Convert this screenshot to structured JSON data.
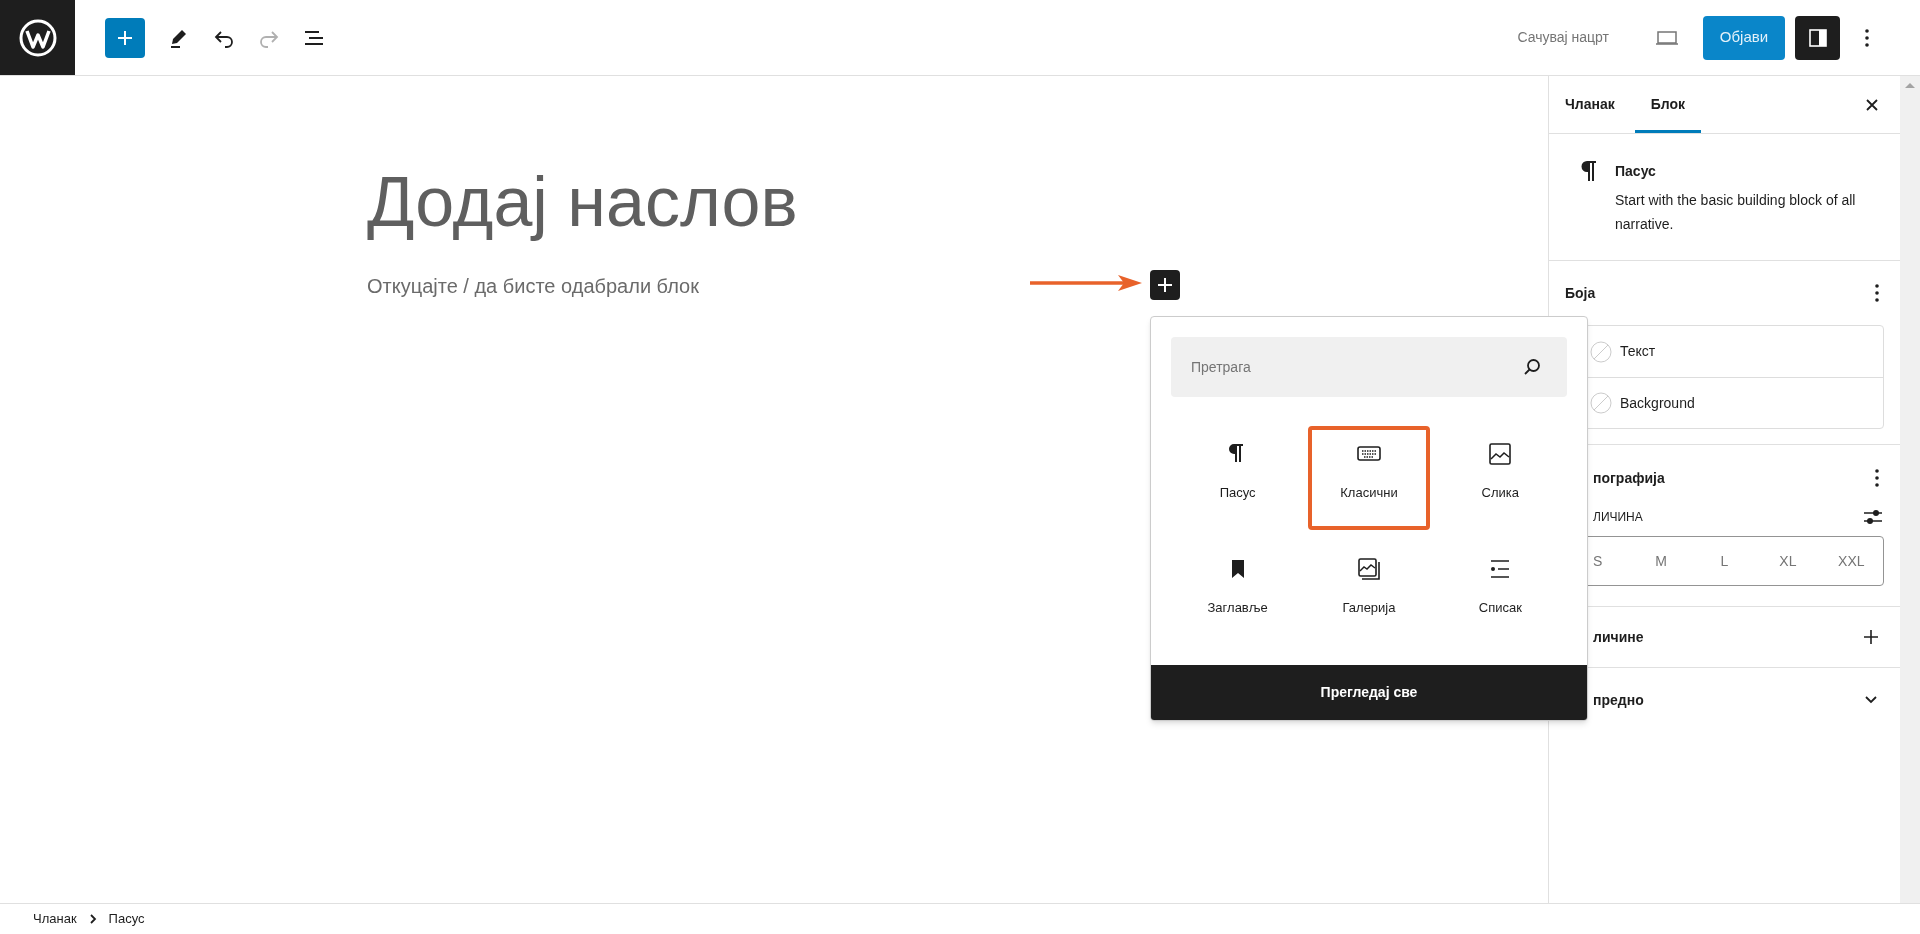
{
  "toolbar": {
    "save_draft": "Сачувај нацрт",
    "publish": "Објави"
  },
  "editor": {
    "title_placeholder": "Додај наслов",
    "paragraph_placeholder": "Откуцајте / да бисте одабрали блок"
  },
  "inserter": {
    "search_placeholder": "Претрага",
    "blocks": [
      {
        "kind": "paragraph",
        "label": "Пасус",
        "highlighted": false
      },
      {
        "kind": "classic",
        "label": "Класични",
        "highlighted": true
      },
      {
        "kind": "image",
        "label": "Слика",
        "highlighted": false
      },
      {
        "kind": "heading",
        "label": "Заглавље",
        "highlighted": false
      },
      {
        "kind": "gallery",
        "label": "Галерија",
        "highlighted": false
      },
      {
        "kind": "list",
        "label": "Списак",
        "highlighted": false
      }
    ],
    "browse_all": "Прегледај све"
  },
  "sidebar": {
    "tabs": [
      {
        "label": "Чланак",
        "selected": false
      },
      {
        "label": "Блок",
        "selected": true
      }
    ],
    "block": {
      "name": "Пасус",
      "description": "Start with the basic building block of all narrative."
    },
    "color": {
      "title": "Боја",
      "options": [
        "Текст",
        "Background"
      ]
    },
    "typography": {
      "title": "пографија",
      "size_label": "ЛИЧИНА",
      "sizes": [
        "S",
        "M",
        "L",
        "XL",
        "XXL"
      ]
    },
    "dimensions": {
      "title": "личине"
    },
    "advanced": {
      "title": "предно"
    }
  },
  "breadcrumb": [
    "Чланак",
    "Пасус"
  ]
}
